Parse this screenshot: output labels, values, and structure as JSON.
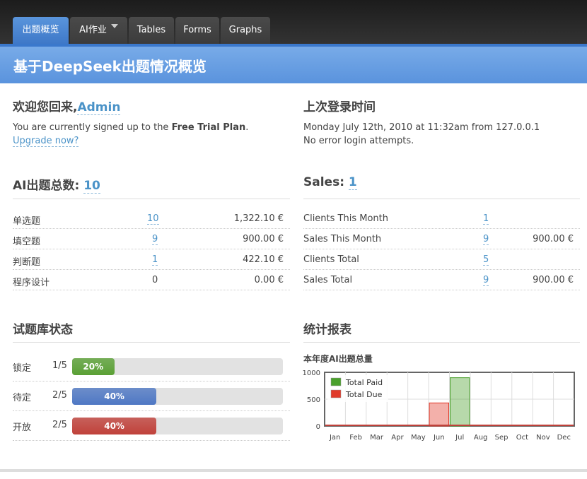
{
  "nav": {
    "tabs": [
      {
        "label": "出题概览"
      },
      {
        "label": "AI作业"
      },
      {
        "label": "Tables"
      },
      {
        "label": "Forms"
      },
      {
        "label": "Graphs"
      }
    ]
  },
  "header": {
    "title": "基于DeepSeek出题情况概览"
  },
  "welcome": {
    "title": "欢迎您回来,",
    "user": "Admin",
    "line_pre": "You are currently signed up to the ",
    "plan": "Free Trial Plan",
    "line_post": ".",
    "upgrade": "Upgrade now?"
  },
  "last_login": {
    "title": "上次登录时间",
    "line1": "Monday July 12th, 2010 at 11:32am from 127.0.0.1",
    "line2": "No error login attempts."
  },
  "ai_total": {
    "title": "AI出题总数:",
    "count": "10",
    "rows": [
      {
        "name": "单选题",
        "count": "10",
        "amount": "1,322.10 €",
        "link": true
      },
      {
        "name": "填空题",
        "count": "9",
        "amount": "900.00 €",
        "link": true
      },
      {
        "name": "判断题",
        "count": "1",
        "amount": "422.10 €",
        "link": true
      },
      {
        "name": "程序设计",
        "count": "0",
        "amount": "0.00 €",
        "link": false
      }
    ]
  },
  "sales": {
    "title": "Sales:",
    "count": "1",
    "rows": [
      {
        "name": "Clients This Month",
        "count": "1",
        "amount": ""
      },
      {
        "name": "Sales This Month",
        "count": "9",
        "amount": "900.00 €"
      },
      {
        "name": "Clients Total",
        "count": "5",
        "amount": ""
      },
      {
        "name": "Sales Total",
        "count": "9",
        "amount": "900.00 €"
      }
    ]
  },
  "bank_status": {
    "title": "试题库状态",
    "rows": [
      {
        "label": "锁定",
        "fraction": "1/5",
        "percent": 20,
        "percent_label": "20%",
        "color": "#5aa035"
      },
      {
        "label": "待定",
        "fraction": "2/5",
        "percent": 40,
        "percent_label": "40%",
        "color": "#4f78c4"
      },
      {
        "label": "开放",
        "fraction": "2/5",
        "percent": 40,
        "percent_label": "40%",
        "color": "#c0413a"
      }
    ]
  },
  "report": {
    "title": "统计报表"
  },
  "chart_data": {
    "type": "bar",
    "title": "本年度AI出题总量",
    "categories": [
      "Jan",
      "Feb",
      "Mar",
      "Apr",
      "May",
      "Jun",
      "Jul",
      "Aug",
      "Sep",
      "Oct",
      "Nov",
      "Dec"
    ],
    "series": [
      {
        "name": "Total Paid",
        "color": "#4aa02c",
        "values": [
          0,
          0,
          0,
          0,
          0,
          0,
          900,
          0,
          0,
          0,
          0,
          0
        ]
      },
      {
        "name": "Total Due",
        "color": "#e03a2a",
        "values": [
          0,
          0,
          0,
          0,
          0,
          430,
          0,
          0,
          0,
          0,
          0,
          0
        ]
      }
    ],
    "yticks": [
      "0",
      "500",
      "1000"
    ],
    "ylim": [
      0,
      1000
    ],
    "legend": "top-left",
    "grid": true
  }
}
